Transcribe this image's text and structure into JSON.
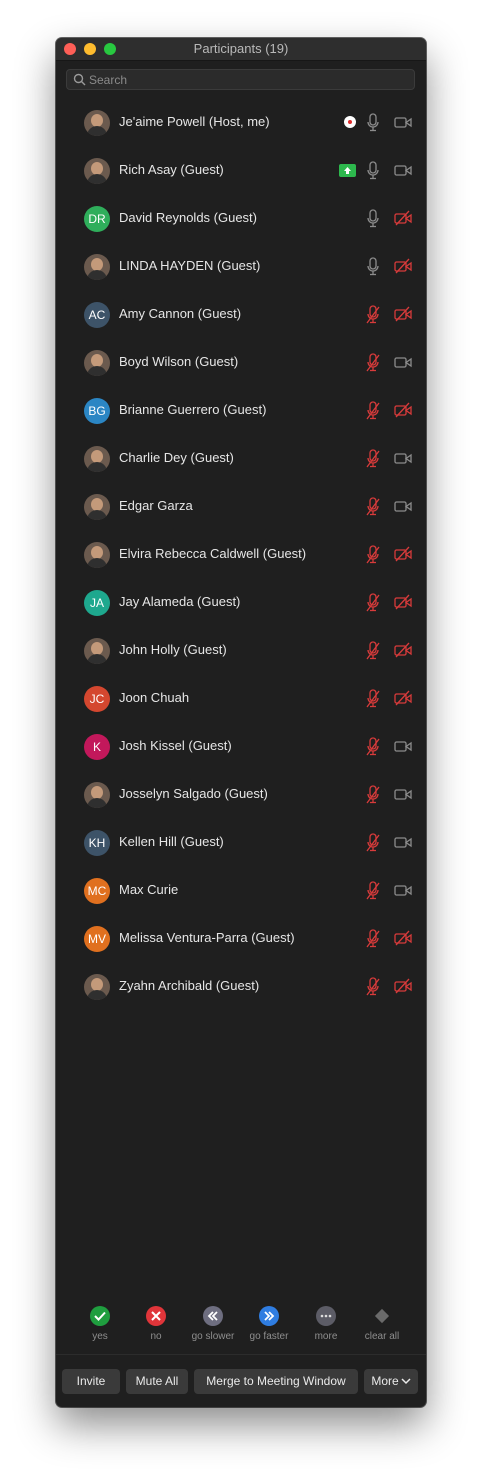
{
  "window": {
    "title": "Participants (19)"
  },
  "search": {
    "placeholder": "Search"
  },
  "participants": [
    {
      "name": "Je'aime Powell (Host, me)",
      "avatar_type": "photo",
      "initials": "",
      "status_icon": "recording",
      "mic": "on",
      "video": "on"
    },
    {
      "name": "Rich Asay (Guest)",
      "avatar_type": "photo",
      "initials": "",
      "status_icon": "screen-share",
      "mic": "on",
      "video": "on"
    },
    {
      "name": "David Reynolds (Guest)",
      "avatar_type": "initials",
      "initials": "DR",
      "color": "#2fae5b",
      "mic": "on",
      "video": "off"
    },
    {
      "name": "LINDA HAYDEN (Guest)",
      "avatar_type": "photo",
      "initials": "",
      "mic": "on",
      "video": "off"
    },
    {
      "name": "Amy Cannon (Guest)",
      "avatar_type": "initials",
      "initials": "AC",
      "color": "#3d5368",
      "mic": "muted",
      "video": "off"
    },
    {
      "name": "Boyd Wilson (Guest)",
      "avatar_type": "photo",
      "initials": "",
      "mic": "muted",
      "video": "on"
    },
    {
      "name": "Brianne Guerrero (Guest)",
      "avatar_type": "initials",
      "initials": "BG",
      "color": "#2b86c4",
      "mic": "muted",
      "video": "off"
    },
    {
      "name": "Charlie Dey (Guest)",
      "avatar_type": "photo",
      "initials": "",
      "mic": "muted",
      "video": "on"
    },
    {
      "name": "Edgar Garza",
      "avatar_type": "photo",
      "initials": "",
      "mic": "muted",
      "video": "on"
    },
    {
      "name": "Elvira Rebecca Caldwell (Guest)",
      "avatar_type": "photo",
      "initials": "",
      "mic": "muted",
      "video": "off"
    },
    {
      "name": "Jay Alameda (Guest)",
      "avatar_type": "initials",
      "initials": "JA",
      "color": "#1ea88e",
      "mic": "muted",
      "video": "off"
    },
    {
      "name": "John Holly (Guest)",
      "avatar_type": "photo",
      "initials": "",
      "mic": "muted",
      "video": "off"
    },
    {
      "name": "Joon Chuah",
      "avatar_type": "initials",
      "initials": "JC",
      "color": "#d4472f",
      "mic": "muted",
      "video": "off"
    },
    {
      "name": "Josh Kissel (Guest)",
      "avatar_type": "initials",
      "initials": "K",
      "color": "#c2185b",
      "mic": "muted",
      "video": "on"
    },
    {
      "name": "Josselyn Salgado (Guest)",
      "avatar_type": "photo",
      "initials": "",
      "mic": "muted",
      "video": "on"
    },
    {
      "name": "Kellen Hill (Guest)",
      "avatar_type": "initials",
      "initials": "KH",
      "color": "#3d5368",
      "mic": "muted",
      "video": "on"
    },
    {
      "name": "Max Curie",
      "avatar_type": "initials",
      "initials": "MC",
      "color": "#e0701f",
      "mic": "muted",
      "video": "on"
    },
    {
      "name": "Melissa Ventura-Parra (Guest)",
      "avatar_type": "initials",
      "initials": "MV",
      "color": "#e0701f",
      "mic": "muted",
      "video": "off"
    },
    {
      "name": "Zyahn Archibald (Guest)",
      "avatar_type": "photo",
      "initials": "",
      "mic": "muted",
      "video": "off"
    }
  ],
  "reactions": [
    {
      "label": "yes",
      "color": "#1f9e3f",
      "icon": "check-icon"
    },
    {
      "label": "no",
      "color": "#e0353a",
      "icon": "x-icon"
    },
    {
      "label": "go slower",
      "color": "#6e6e80",
      "icon": "rewind-icon"
    },
    {
      "label": "go faster",
      "color": "#2f7de1",
      "icon": "fast-forward-icon"
    },
    {
      "label": "more",
      "color": "#5c5c66",
      "icon": "ellipsis-icon"
    },
    {
      "label": "clear all",
      "color": "#555555",
      "icon": "eraser-icon"
    }
  ],
  "buttons": {
    "invite": "Invite",
    "mute_all": "Mute All",
    "merge": "Merge to Meeting Window",
    "more": "More"
  },
  "colors": {
    "muted_red": "#d83b3b",
    "icon_gray": "#8c8c8c"
  }
}
